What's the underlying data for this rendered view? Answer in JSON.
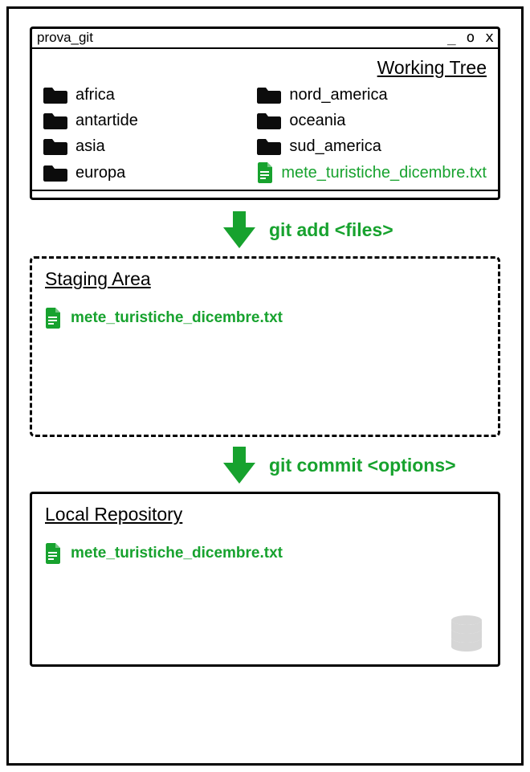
{
  "window": {
    "title": "prova_git",
    "controls": "_ o x"
  },
  "working_tree": {
    "heading": "Working Tree",
    "folders_col1": [
      "africa",
      "antartide",
      "asia",
      "europa"
    ],
    "folders_col2": [
      "nord_america",
      "oceania",
      "sud_america"
    ],
    "file": "mete_turistiche_dicembre.txt"
  },
  "arrow1": {
    "command": "git add <files>"
  },
  "staging": {
    "heading": "Staging Area",
    "file": "mete_turistiche_dicembre.txt"
  },
  "arrow2": {
    "command": "git commit <options>"
  },
  "repo": {
    "heading": "Local Repository",
    "file": "mete_turistiche_dicembre.txt"
  },
  "colors": {
    "accent": "#17a22e",
    "folder": "#0c0c0c",
    "db": "#d6d6d6"
  }
}
